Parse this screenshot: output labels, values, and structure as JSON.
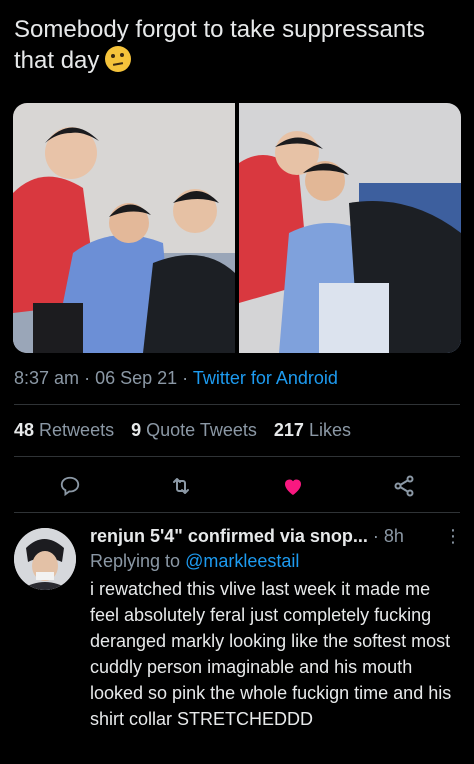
{
  "tweet": {
    "text": "Somebody forgot to take suppressants that day",
    "emoji": "face-with-raised-eyebrow"
  },
  "meta": {
    "time": "8:37 am",
    "sep": "·",
    "date": "06 Sep 21",
    "source": "Twitter for Android"
  },
  "stats": {
    "retweets": "48",
    "retweets_label": "Retweets",
    "quotes": "9",
    "quotes_label": "Quote Tweets",
    "likes": "217",
    "likes_label": "Likes"
  },
  "actions": {
    "reply_icon": "speech-bubble-icon",
    "retweet_icon": "retweet-icon",
    "like_icon": "heart-icon",
    "like_color": "#f91880",
    "share_icon": "share-icon"
  },
  "reply": {
    "name": "renjun 5'4\" confirmed via snop...",
    "sep": "·",
    "time": "8h",
    "more": "⋮",
    "replying_prefix": "Replying to",
    "replying_handle": "@markleestail",
    "text": "i rewatched this vlive last week it made me feel absolutely feral just completely fucking deranged markly looking like the softest most cuddly person imaginable and his mouth looked so pink the whole fuckign time and his shirt collar STRETCHEDDD"
  },
  "colors": {
    "background": "#000000",
    "text": "#e7e9ea",
    "muted": "#8b98a5",
    "accent": "#1d9bf0",
    "divider": "#2f3336"
  }
}
